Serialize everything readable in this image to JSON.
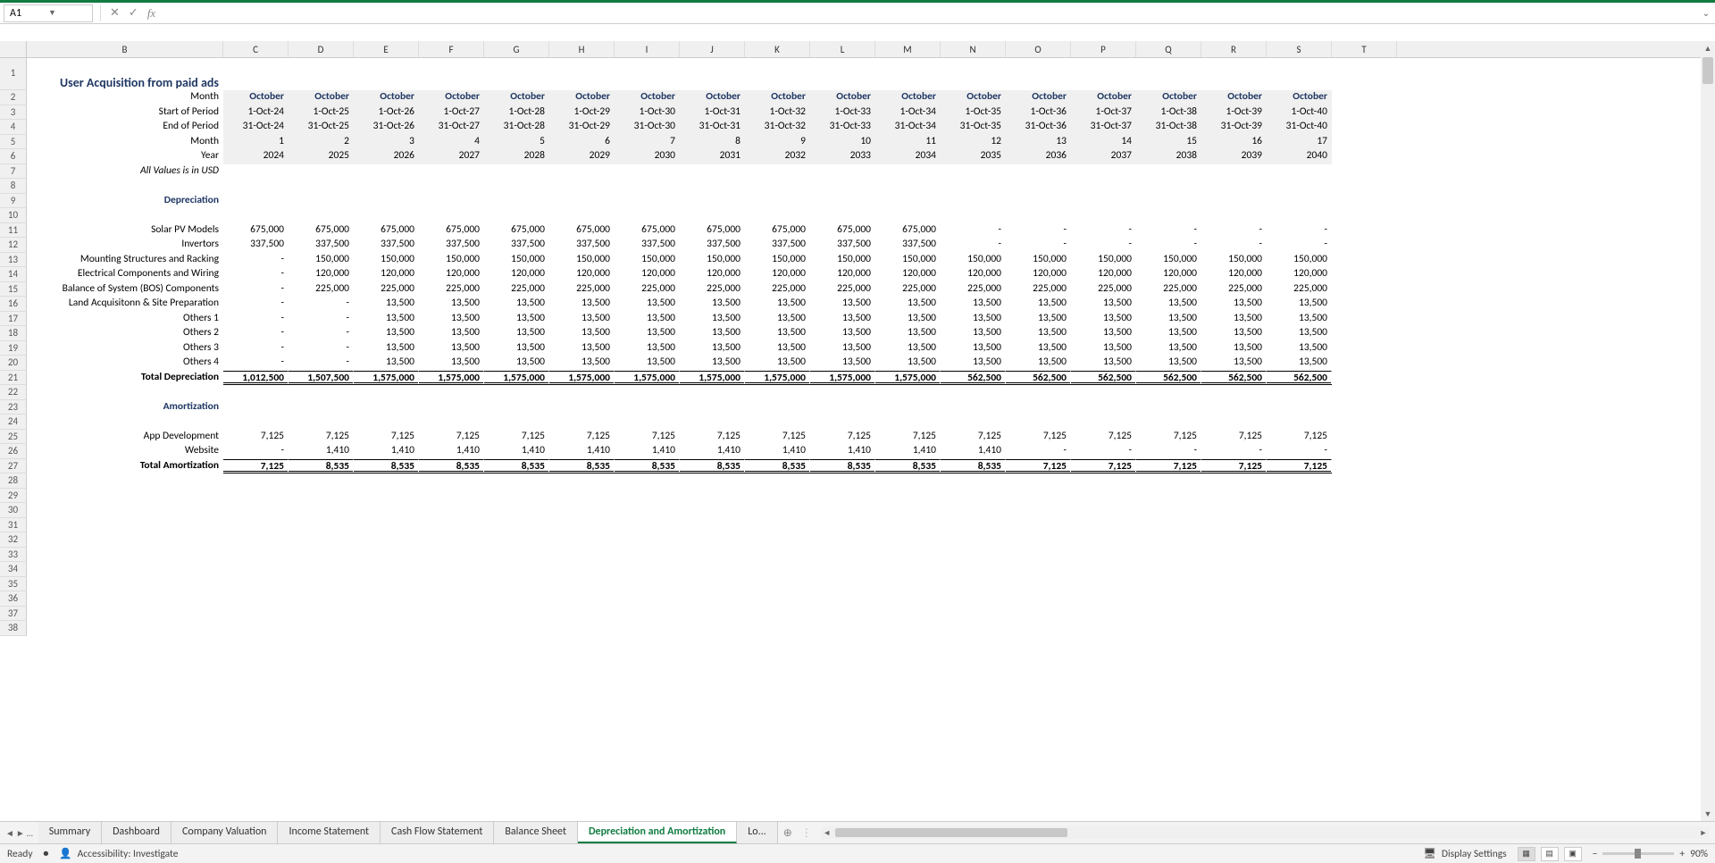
{
  "nameBox": "A1",
  "title": "User Acquisition from paid ads",
  "rowLabels": [
    "Month",
    "Start of Period",
    "End of Period",
    "Month",
    "Year",
    "All Values is in USD"
  ],
  "sectionDepr": "Depreciation",
  "sectionAmort": "Amortization",
  "columns": [
    "B",
    "C",
    "D",
    "E",
    "F",
    "G",
    "H",
    "I",
    "J",
    "K",
    "L",
    "M",
    "N",
    "O",
    "P",
    "Q",
    "R",
    "S",
    "T"
  ],
  "colB_width": 220,
  "dataColWidth": 73,
  "months": [
    "October",
    "October",
    "October",
    "October",
    "October",
    "October",
    "October",
    "October",
    "October",
    "October",
    "October",
    "October",
    "October",
    "October",
    "October",
    "October",
    "October",
    "October"
  ],
  "startPeriod": [
    "1-Oct-24",
    "1-Oct-25",
    "1-Oct-26",
    "1-Oct-27",
    "1-Oct-28",
    "1-Oct-29",
    "1-Oct-30",
    "1-Oct-31",
    "1-Oct-32",
    "1-Oct-33",
    "1-Oct-34",
    "1-Oct-35",
    "1-Oct-36",
    "1-Oct-37",
    "1-Oct-38",
    "1-Oct-39",
    "1-Oct-40"
  ],
  "endPeriod": [
    "31-Oct-24",
    "31-Oct-25",
    "31-Oct-26",
    "31-Oct-27",
    "31-Oct-28",
    "31-Oct-29",
    "31-Oct-30",
    "31-Oct-31",
    "31-Oct-32",
    "31-Oct-33",
    "31-Oct-34",
    "31-Oct-35",
    "31-Oct-36",
    "31-Oct-37",
    "31-Oct-38",
    "31-Oct-39",
    "31-Oct-40"
  ],
  "monthNums": [
    "1",
    "2",
    "3",
    "4",
    "5",
    "6",
    "7",
    "8",
    "9",
    "10",
    "11",
    "12",
    "13",
    "14",
    "15",
    "16",
    "17"
  ],
  "years": [
    "2024",
    "2025",
    "2026",
    "2027",
    "2028",
    "2029",
    "2030",
    "2031",
    "2032",
    "2033",
    "2034",
    "2035",
    "2036",
    "2037",
    "2038",
    "2039",
    "2040"
  ],
  "deprRows": [
    {
      "label": "Solar PV Models",
      "v": [
        "675,000",
        "675,000",
        "675,000",
        "675,000",
        "675,000",
        "675,000",
        "675,000",
        "675,000",
        "675,000",
        "675,000",
        "675,000",
        "-",
        "-",
        "-",
        "-",
        "-",
        "-"
      ]
    },
    {
      "label": "Invertors",
      "v": [
        "337,500",
        "337,500",
        "337,500",
        "337,500",
        "337,500",
        "337,500",
        "337,500",
        "337,500",
        "337,500",
        "337,500",
        "337,500",
        "-",
        "-",
        "-",
        "-",
        "-",
        "-"
      ]
    },
    {
      "label": "Mounting Structures and Racking",
      "v": [
        "-",
        "150,000",
        "150,000",
        "150,000",
        "150,000",
        "150,000",
        "150,000",
        "150,000",
        "150,000",
        "150,000",
        "150,000",
        "150,000",
        "150,000",
        "150,000",
        "150,000",
        "150,000",
        "150,000"
      ]
    },
    {
      "label": "Electrical Components and Wiring",
      "v": [
        "-",
        "120,000",
        "120,000",
        "120,000",
        "120,000",
        "120,000",
        "120,000",
        "120,000",
        "120,000",
        "120,000",
        "120,000",
        "120,000",
        "120,000",
        "120,000",
        "120,000",
        "120,000",
        "120,000"
      ]
    },
    {
      "label": "Balance of System (BOS) Components",
      "v": [
        "-",
        "225,000",
        "225,000",
        "225,000",
        "225,000",
        "225,000",
        "225,000",
        "225,000",
        "225,000",
        "225,000",
        "225,000",
        "225,000",
        "225,000",
        "225,000",
        "225,000",
        "225,000",
        "225,000"
      ]
    },
    {
      "label": "Land Acquisitonn & Site Preparation",
      "v": [
        "-",
        "-",
        "13,500",
        "13,500",
        "13,500",
        "13,500",
        "13,500",
        "13,500",
        "13,500",
        "13,500",
        "13,500",
        "13,500",
        "13,500",
        "13,500",
        "13,500",
        "13,500",
        "13,500"
      ]
    },
    {
      "label": "Others 1",
      "v": [
        "-",
        "-",
        "13,500",
        "13,500",
        "13,500",
        "13,500",
        "13,500",
        "13,500",
        "13,500",
        "13,500",
        "13,500",
        "13,500",
        "13,500",
        "13,500",
        "13,500",
        "13,500",
        "13,500"
      ]
    },
    {
      "label": "Others 2",
      "v": [
        "-",
        "-",
        "13,500",
        "13,500",
        "13,500",
        "13,500",
        "13,500",
        "13,500",
        "13,500",
        "13,500",
        "13,500",
        "13,500",
        "13,500",
        "13,500",
        "13,500",
        "13,500",
        "13,500"
      ]
    },
    {
      "label": "Others 3",
      "v": [
        "-",
        "-",
        "13,500",
        "13,500",
        "13,500",
        "13,500",
        "13,500",
        "13,500",
        "13,500",
        "13,500",
        "13,500",
        "13,500",
        "13,500",
        "13,500",
        "13,500",
        "13,500",
        "13,500"
      ]
    },
    {
      "label": "Others 4",
      "v": [
        "-",
        "-",
        "13,500",
        "13,500",
        "13,500",
        "13,500",
        "13,500",
        "13,500",
        "13,500",
        "13,500",
        "13,500",
        "13,500",
        "13,500",
        "13,500",
        "13,500",
        "13,500",
        "13,500"
      ]
    }
  ],
  "totalDepr": {
    "label": "Total Depreciation",
    "v": [
      "1,012,500",
      "1,507,500",
      "1,575,000",
      "1,575,000",
      "1,575,000",
      "1,575,000",
      "1,575,000",
      "1,575,000",
      "1,575,000",
      "1,575,000",
      "1,575,000",
      "562,500",
      "562,500",
      "562,500",
      "562,500",
      "562,500",
      "562,500"
    ]
  },
  "amortRows": [
    {
      "label": "App Development",
      "v": [
        "7,125",
        "7,125",
        "7,125",
        "7,125",
        "7,125",
        "7,125",
        "7,125",
        "7,125",
        "7,125",
        "7,125",
        "7,125",
        "7,125",
        "7,125",
        "7,125",
        "7,125",
        "7,125",
        "7,125"
      ]
    },
    {
      "label": "Website",
      "v": [
        "-",
        "1,410",
        "1,410",
        "1,410",
        "1,410",
        "1,410",
        "1,410",
        "1,410",
        "1,410",
        "1,410",
        "1,410",
        "1,410",
        "-",
        "-",
        "-",
        "-",
        "-"
      ]
    }
  ],
  "totalAmort": {
    "label": "Total Amortization",
    "v": [
      "7,125",
      "8,535",
      "8,535",
      "8,535",
      "8,535",
      "8,535",
      "8,535",
      "8,535",
      "8,535",
      "8,535",
      "8,535",
      "8,535",
      "7,125",
      "7,125",
      "7,125",
      "7,125",
      "7,125"
    ]
  },
  "sheetTabs": [
    "Summary",
    "Dashboard",
    "Company Valuation",
    "Income Statement",
    "Cash Flow Statement",
    "Balance Sheet",
    "Depreciation and Amortization",
    "Lo..."
  ],
  "activeTab": 6,
  "status": {
    "ready": "Ready",
    "acc": "Accessibility: Investigate",
    "disp": "Display Settings",
    "zoom": "90%"
  },
  "rowNums": 38
}
